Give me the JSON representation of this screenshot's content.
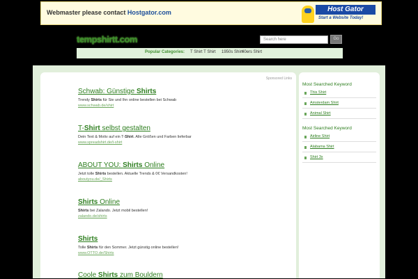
{
  "banner": {
    "text": "Webmaster please contact",
    "link": "Hostgator.com",
    "brand": "Host Gator",
    "tagline": "Start a Website Today!"
  },
  "header": {
    "logo": "tempshirtt.com",
    "search_placeholder": "Search here",
    "search_button": "Go",
    "popular_label": "Popular Categories:",
    "popular": [
      "T Shirt T Shirt",
      "1950s Shirt",
      "40ers Shirt"
    ]
  },
  "main": {
    "sponsored": "Sponsored Links",
    "ads": [
      {
        "title_pre": "Schwab: Günstige ",
        "title_bold": "Shirts",
        "title_post": "",
        "desc_pre": "Trendy ",
        "desc_bold": "Shirts",
        "desc_post": " für Sie und Ihn online bestellen bei Schwab",
        "url": "www.schwab.de/shirt"
      },
      {
        "title_pre": "T-",
        "title_bold": "Shirt",
        "title_post": " selbst gestalten",
        "desc_pre": "Dein Text & Motiv auf ein T-",
        "desc_bold": "Shirt",
        "desc_post": ". Alle Größen und Farben lieferbar",
        "url": "www.spreadshirt.de/t-shirt"
      },
      {
        "title_pre": "ABOUT YOU: ",
        "title_bold": "Shirts",
        "title_post": " Online",
        "desc_pre": "Jetzt tolle ",
        "desc_bold": "Shirts",
        "desc_post": " bestellen. Aktuelle Trends & 0€ Versandkosten!",
        "url": "aboutyou.de/_Shirts"
      },
      {
        "title_pre": "",
        "title_bold": "Shirts",
        "title_post": " Online",
        "desc_pre": "",
        "desc_bold": "Shirts",
        "desc_post": " bei Zalando. Jetzt mobil bestellen!",
        "url": "zalando.de/shirts"
      },
      {
        "title_pre": "",
        "title_bold": "Shirts",
        "title_post": "",
        "desc_pre": "Tolle ",
        "desc_bold": "Shirts",
        "desc_post": " für den Sommer. Jetzt günstig online bestellen!",
        "url": "www.OTTO.de/Shirts"
      },
      {
        "title_pre": "Coole ",
        "title_bold": "Shirts",
        "title_post": " zum Bouldern",
        "desc_pre": "",
        "desc_bold": "",
        "desc_post": "",
        "url": ""
      }
    ]
  },
  "sidebar": {
    "sections": [
      {
        "heading": "Most Searched Keyword",
        "items": [
          "This Shirt",
          "Amsterdam Shirt",
          "Animal Shirt"
        ]
      },
      {
        "heading": "Most Searched Keyword",
        "items": [
          "Airline Shirt",
          "Alabama Shirt",
          "Shirt 3x"
        ]
      }
    ]
  }
}
